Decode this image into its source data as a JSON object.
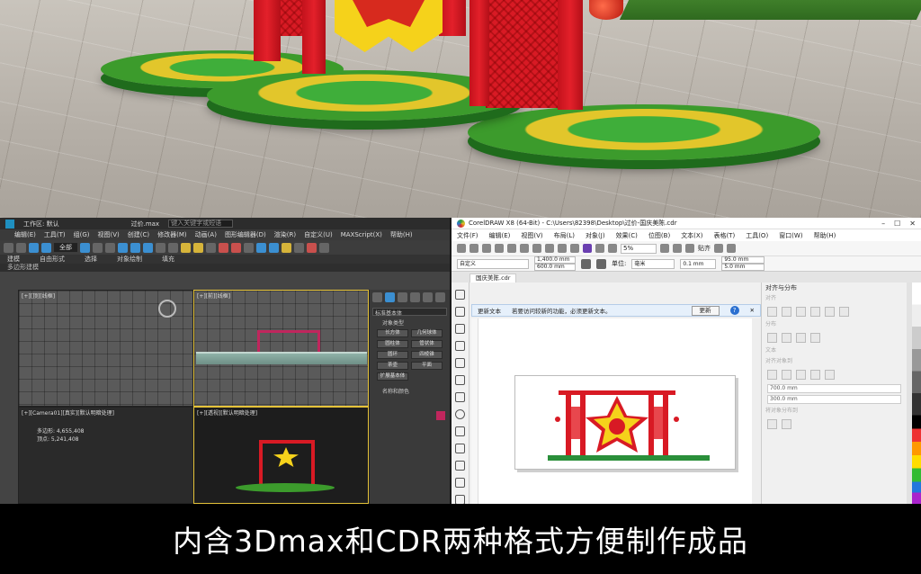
{
  "caption": "内含3Dmax和CDR两种格式方便制作成品",
  "max": {
    "file_label": "过价.max",
    "workspace": "工作区: 默认",
    "search_placeholder": "键入关键字或短语",
    "menu": [
      "编辑(E)",
      "工具(T)",
      "组(G)",
      "视图(V)",
      "创建(C)",
      "修改器(M)",
      "动画(A)",
      "图形编辑器(D)",
      "渲染(R)",
      "自定义(U)",
      "MAXScript(X)",
      "帮助(H)"
    ],
    "ribbon_tabs": [
      "建模",
      "自由形式",
      "选择",
      "对象绘制",
      "填充"
    ],
    "ribbon_sub": "多边形建模",
    "view_all": "全部",
    "viewports": [
      {
        "label": "[+][顶][线框]"
      },
      {
        "label": "[+][前][线框]"
      },
      {
        "label": "[+][Camera01][真实][默认明暗处理]"
      },
      {
        "label": "[+][透视][默认明暗处理]"
      }
    ],
    "stats": [
      "多边形: 4,655,408",
      "顶点: 5,241,408"
    ],
    "command_panel": {
      "dropdown": "标准基本体",
      "section": "对象类型",
      "buttons": [
        "长方体",
        "几何球体",
        "圆柱体",
        "管状体",
        "圆环",
        "四棱锥",
        "茶壶",
        "平面",
        "扩展基本体"
      ],
      "name_section": "名称和颜色"
    }
  },
  "cdr": {
    "title": "CorelDRAW X8 (64-Bit) - C:\\Users\\82398\\Desktop\\过价-国庆美陈.cdr",
    "menu": [
      "文件(F)",
      "编辑(E)",
      "视图(V)",
      "布局(L)",
      "对象(J)",
      "效果(C)",
      "位图(B)",
      "文本(X)",
      "表格(T)",
      "工具(O)",
      "窗口(W)",
      "帮助(H)"
    ],
    "zoom": "5%",
    "snap_label": "贴齐",
    "page_preset": "自定义",
    "width": "1,400.0 mm",
    "height": "600.0 mm",
    "units_label": "单位:",
    "units": "毫米",
    "nudge": "0.1 mm",
    "dup_x": "95.0 mm",
    "dup_y": "5.0 mm",
    "tab": "国庆美陈.cdr",
    "notice": {
      "title": "更新文本",
      "message": "若要访问较新的功能，必须更新文本。",
      "button": "更新"
    },
    "dock": {
      "title": "对齐与分布",
      "align": "对齐",
      "distribute": "分布",
      "text": "文本",
      "objects": "对齐对象到",
      "x": "700.0 mm",
      "y": "300.0 mm",
      "distribute_to": "将对象分布到"
    }
  },
  "colors": {
    "gate_red": "#d81a24",
    "star_yellow": "#f5d21b",
    "grass": "#3c9b2c"
  }
}
